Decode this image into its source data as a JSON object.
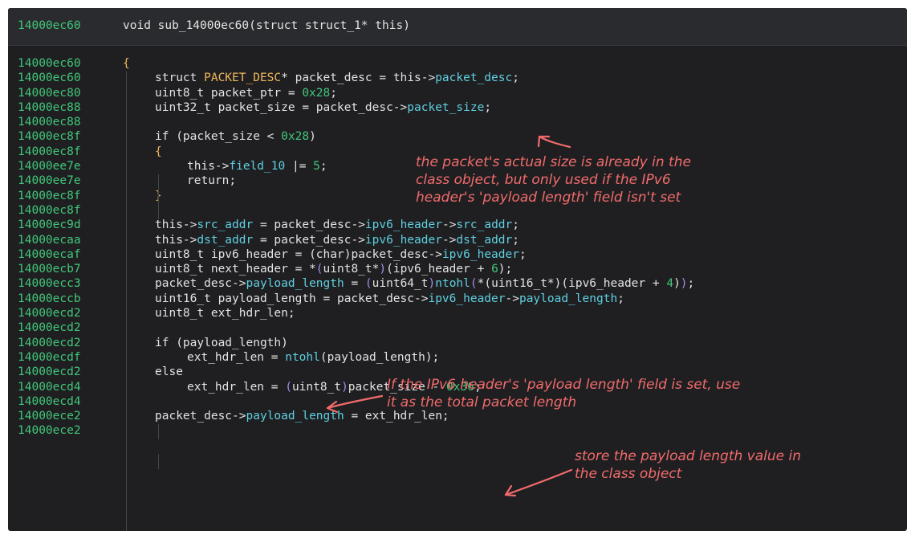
{
  "header": {
    "address": "14000ec60",
    "signature": "void sub_14000ec60(struct struct_1* this)"
  },
  "lines": [
    {
      "addr": "14000ec60",
      "indent": 0,
      "tokens": [
        [
          "t-brace",
          "{"
        ]
      ]
    },
    {
      "addr": "14000ec60",
      "indent": 1,
      "tokens": [
        [
          "t-kw",
          "struct "
        ],
        [
          "t-struct",
          "PACKET_DESC"
        ],
        [
          "t-op",
          "* packet_desc = this->"
        ],
        [
          "t-field",
          "packet_desc"
        ],
        [
          "t-op",
          ";"
        ]
      ]
    },
    {
      "addr": "14000ec80",
      "indent": 1,
      "tokens": [
        [
          "t-type",
          "uint8_t packet_ptr = "
        ],
        [
          "t-num",
          "0x28"
        ],
        [
          "t-op",
          ";"
        ]
      ]
    },
    {
      "addr": "14000ec88",
      "indent": 1,
      "tokens": [
        [
          "t-type",
          "uint32_t packet_size = packet_desc->"
        ],
        [
          "t-field",
          "packet_size"
        ],
        [
          "t-op",
          ";"
        ]
      ]
    },
    {
      "addr": "14000ec88",
      "indent": 1,
      "tokens": []
    },
    {
      "addr": "14000ec8f",
      "indent": 1,
      "tokens": [
        [
          "t-kw",
          "if (packet_size < "
        ],
        [
          "t-num",
          "0x28"
        ],
        [
          "t-op",
          ")"
        ]
      ]
    },
    {
      "addr": "14000ec8f",
      "indent": 1,
      "tokens": [
        [
          "t-brace",
          "{"
        ]
      ]
    },
    {
      "addr": "14000ee7e",
      "indent": 2,
      "tokens": [
        [
          "t-op",
          "this->"
        ],
        [
          "t-field",
          "field_10"
        ],
        [
          "t-op",
          " |= "
        ],
        [
          "t-num",
          "5"
        ],
        [
          "t-op",
          ";"
        ]
      ]
    },
    {
      "addr": "14000ee7e",
      "indent": 2,
      "tokens": [
        [
          "t-kw",
          "return"
        ],
        [
          "t-op",
          ";"
        ]
      ]
    },
    {
      "addr": "14000ec8f",
      "indent": 1,
      "tokens": [
        [
          "t-brace",
          "}"
        ]
      ]
    },
    {
      "addr": "14000ec8f",
      "indent": 1,
      "tokens": []
    },
    {
      "addr": "14000ec9d",
      "indent": 1,
      "tokens": [
        [
          "t-op",
          "this->"
        ],
        [
          "t-field",
          "src_addr"
        ],
        [
          "t-op",
          " = packet_desc->"
        ],
        [
          "t-field",
          "ipv6_header"
        ],
        [
          "t-op",
          "->"
        ],
        [
          "t-field",
          "src_addr"
        ],
        [
          "t-op",
          ";"
        ]
      ]
    },
    {
      "addr": "14000ecaa",
      "indent": 1,
      "tokens": [
        [
          "t-op",
          "this->"
        ],
        [
          "t-field",
          "dst_addr"
        ],
        [
          "t-op",
          " = packet_desc->"
        ],
        [
          "t-field",
          "ipv6_header"
        ],
        [
          "t-op",
          "->"
        ],
        [
          "t-field",
          "dst_addr"
        ],
        [
          "t-op",
          ";"
        ]
      ]
    },
    {
      "addr": "14000ecaf",
      "indent": 1,
      "tokens": [
        [
          "t-type",
          "uint8_t ipv6_header = "
        ],
        [
          "t-cast",
          "(char)"
        ],
        [
          "t-op",
          "packet_desc->"
        ],
        [
          "t-field",
          "ipv6_header"
        ],
        [
          "t-op",
          ";"
        ]
      ]
    },
    {
      "addr": "14000ecb7",
      "indent": 1,
      "tokens": [
        [
          "t-type",
          "uint8_t next_header = *"
        ],
        [
          "t-paren",
          "("
        ],
        [
          "t-op",
          "uint8_t*"
        ],
        [
          "t-paren",
          ")"
        ],
        [
          "t-op",
          "(ipv6_header + "
        ],
        [
          "t-num",
          "6"
        ],
        [
          "t-op",
          ");"
        ]
      ]
    },
    {
      "addr": "14000ecc3",
      "indent": 1,
      "tokens": [
        [
          "t-op",
          "packet_desc->"
        ],
        [
          "t-field",
          "payload_length"
        ],
        [
          "t-op",
          " = "
        ],
        [
          "t-paren",
          "("
        ],
        [
          "t-op",
          "uint64_t"
        ],
        [
          "t-paren",
          ")"
        ],
        [
          "t-func",
          "ntohl"
        ],
        [
          "t-paren",
          "("
        ],
        [
          "t-op",
          "*(uint16_t*)(ipv6_header + "
        ],
        [
          "t-num",
          "4"
        ],
        [
          "t-op",
          ")"
        ],
        [
          "t-paren",
          ")"
        ],
        [
          "t-op",
          ";"
        ]
      ]
    },
    {
      "addr": "14000eccb",
      "indent": 1,
      "tokens": [
        [
          "t-type",
          "uint16_t payload_length = packet_desc->"
        ],
        [
          "t-field",
          "ipv6_header"
        ],
        [
          "t-op",
          "->"
        ],
        [
          "t-field",
          "payload_length"
        ],
        [
          "t-op",
          ";"
        ]
      ]
    },
    {
      "addr": "14000ecd2",
      "indent": 1,
      "tokens": [
        [
          "t-type",
          "uint8_t ext_hdr_len;"
        ]
      ]
    },
    {
      "addr": "14000ecd2",
      "indent": 1,
      "tokens": []
    },
    {
      "addr": "14000ecd2",
      "indent": 1,
      "tokens": [
        [
          "t-kw",
          "if (payload_length)"
        ]
      ]
    },
    {
      "addr": "14000ecdf",
      "indent": 2,
      "tokens": [
        [
          "t-op",
          "ext_hdr_len = "
        ],
        [
          "t-func",
          "ntohl"
        ],
        [
          "t-op",
          "(payload_length);"
        ]
      ]
    },
    {
      "addr": "14000ecd2",
      "indent": 1,
      "tokens": [
        [
          "t-kw",
          "else"
        ]
      ]
    },
    {
      "addr": "14000ecd4",
      "indent": 2,
      "tokens": [
        [
          "t-op",
          "ext_hdr_len = "
        ],
        [
          "t-paren",
          "("
        ],
        [
          "t-op",
          "uint8_t"
        ],
        [
          "t-paren",
          ")"
        ],
        [
          "t-op",
          "packet_size - "
        ],
        [
          "t-num",
          "0x36"
        ],
        [
          "t-op",
          ";"
        ]
      ]
    },
    {
      "addr": "14000ecd4",
      "indent": 1,
      "tokens": []
    },
    {
      "addr": "14000ece2",
      "indent": 1,
      "tokens": [
        [
          "t-op",
          "packet_desc->"
        ],
        [
          "t-field",
          "payload_length"
        ],
        [
          "t-op",
          " = ext_hdr_len;"
        ]
      ]
    },
    {
      "addr": "14000ece2",
      "indent": 1,
      "tokens": []
    }
  ],
  "annotations": {
    "packet_size_note": "the packet's actual size is already in the\nclass object, but only used if the IPv6\nheader's 'payload length' field isn't set",
    "payload_length_note": "If the IPv6 header's 'payload length' field is set, use\nit as the total packet length",
    "store_note": "store the payload length value in\nthe class object"
  },
  "colors": {
    "background": "#1f1f22",
    "address": "#41c779",
    "annotation": "#f26b6b"
  }
}
